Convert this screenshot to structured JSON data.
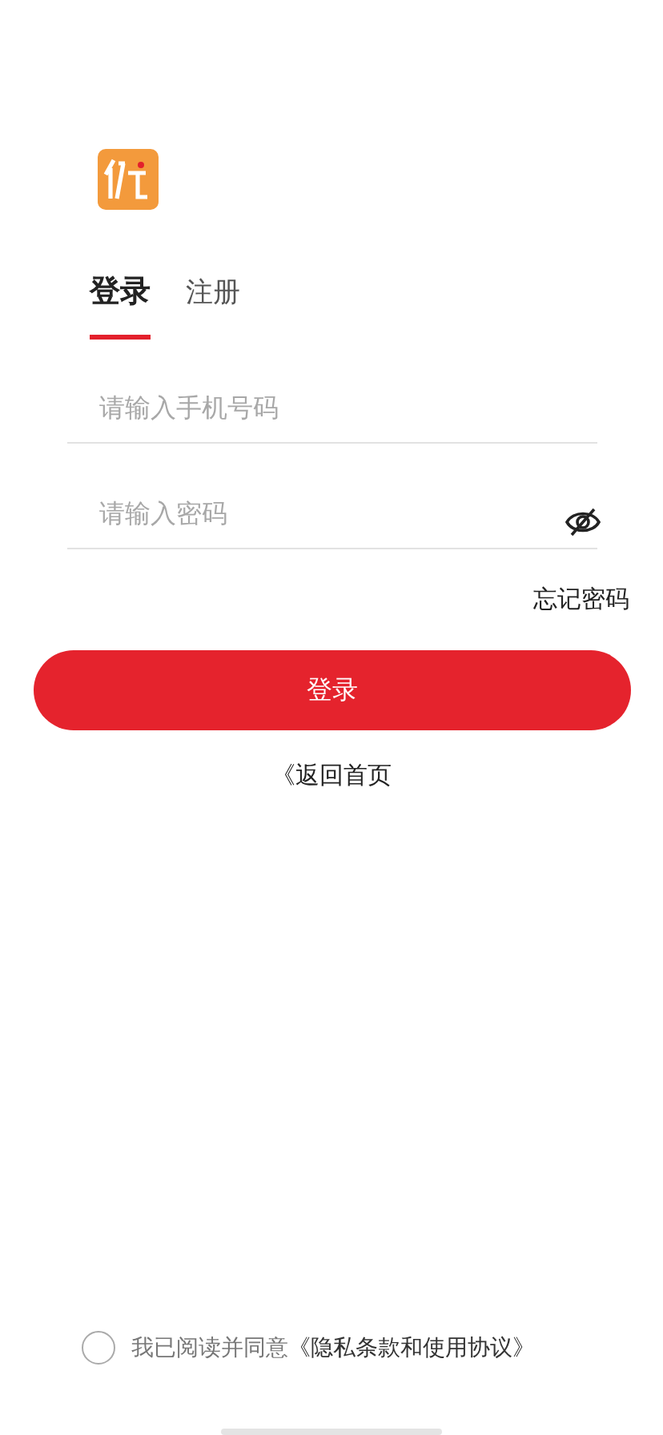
{
  "tabs": [
    {
      "label": "登录",
      "selected": true
    },
    {
      "label": "注册",
      "selected": false
    }
  ],
  "phone_field": {
    "placeholder": "请输入手机号码"
  },
  "password_field": {
    "placeholder": "请输入密码",
    "visible": false
  },
  "forgot_password": "忘记密码",
  "login_button": "登录",
  "back_link": "《返回首页",
  "agreement": {
    "checked": false,
    "text": "我已阅读并同意",
    "link": "《隐私条款和使用协议》"
  }
}
